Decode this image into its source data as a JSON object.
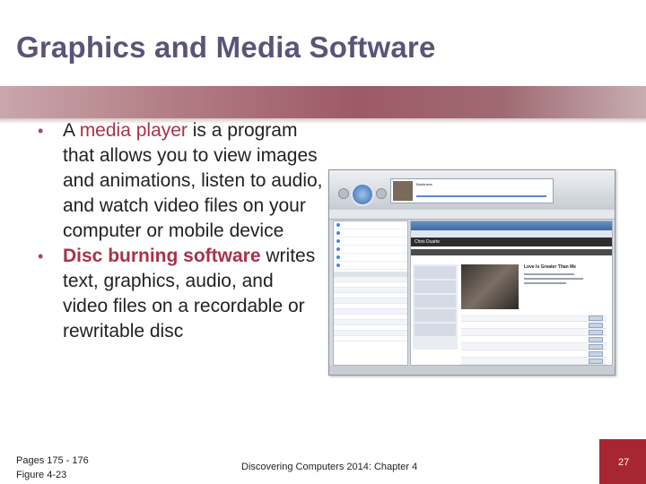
{
  "slide": {
    "title": "Graphics and Media Software",
    "bullets": [
      {
        "prefix": "A ",
        "highlight": "media player",
        "rest": " is a program that allows you to view images and animations, listen to audio, and watch video files on your computer or mobile device"
      },
      {
        "prefix": "",
        "highlight": "Disc burning software",
        "rest": " writes text, graphics, audio, and video files on a recordable or rewritable disc"
      }
    ],
    "footer": {
      "pages": "Pages 175 - 176",
      "figure": "Figure 4-23",
      "course": "Discovering Computers 2014: Chapter 4",
      "page_number": "27"
    }
  },
  "colors": {
    "title": "#5a5478",
    "highlight": "#a8324a",
    "band": "#9d5a66",
    "page_box": "#a82631"
  },
  "screenshot": {
    "now_playing_title": "Baddness",
    "album_title": "Chris Duarte",
    "album_heading": "Love Is Greater Than Me"
  }
}
